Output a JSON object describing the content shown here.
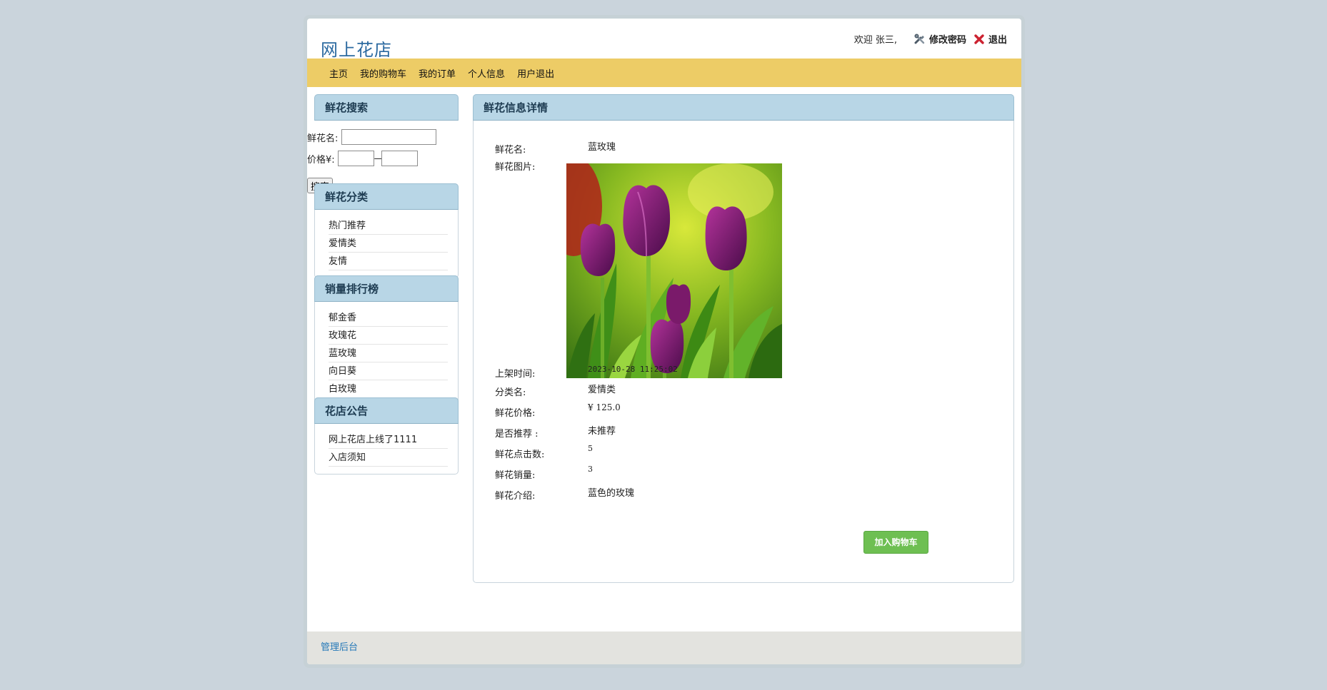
{
  "header": {
    "logo": "网上花店",
    "welcome": "欢迎 张三,",
    "change_password": "修改密码",
    "logout": "退出"
  },
  "nav": [
    "主页",
    "我的购物车",
    "我的订单",
    "个人信息",
    "用户退出"
  ],
  "search": {
    "title": "鲜花搜索",
    "name_label": "鲜花名:",
    "price_label": "价格¥:",
    "dash": "—",
    "button": "搜索",
    "name_value": "",
    "price_min": "",
    "price_max": ""
  },
  "category": {
    "title": "鲜花分类",
    "items": [
      "热门推荐",
      "爱情类",
      "友情"
    ]
  },
  "ranking": {
    "title": "销量排行榜",
    "items": [
      "郁金香",
      "玫瑰花",
      "蓝玫瑰",
      "向日葵",
      "白玫瑰"
    ]
  },
  "notice": {
    "title": "花店公告",
    "items": [
      "网上花店上线了1111",
      "入店须知"
    ]
  },
  "detail": {
    "title": "鲜花信息详情",
    "name_label": "鲜花名:",
    "name": "蓝玫瑰",
    "image_label": "鲜花图片:",
    "time_label": "上架时间:",
    "time": "2023-10-28 11:25:02",
    "category_label": "分类名:",
    "category": "爱情类",
    "price_label": "鲜花价格:",
    "price": "¥ 125.0",
    "recommend_label": "是否推荐 :",
    "recommend": "未推荐",
    "clicks_label": "鲜花点击数:",
    "clicks": "5",
    "sales_label": "鲜花销量:",
    "sales": "3",
    "intro_label": "鲜花介绍:",
    "intro": "蓝色的玫瑰",
    "add_to_cart": "加入购物车"
  },
  "footer": {
    "admin_link": "管理后台"
  },
  "colors": {
    "nav_bg": "#edcc66",
    "panel_header": "#b8d6e6",
    "button_green": "#6ebf52",
    "footer_bg": "#e3e3df",
    "logo": "#2c6aa0"
  }
}
